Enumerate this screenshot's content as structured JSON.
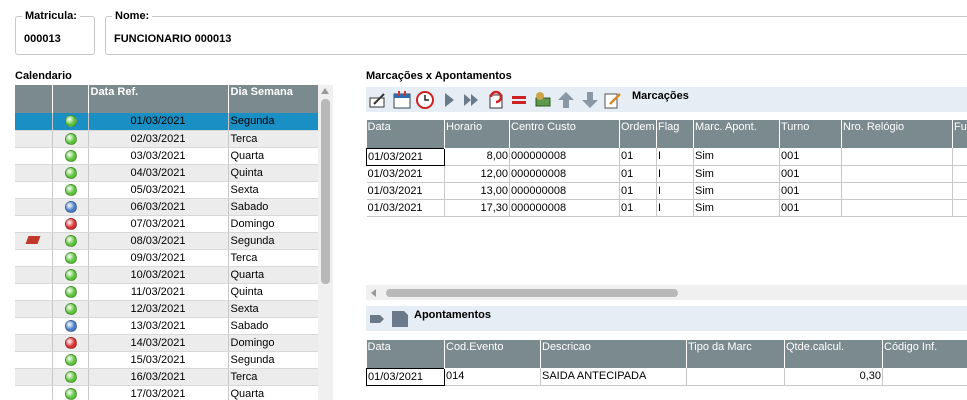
{
  "matricula": {
    "label": "Matricula:",
    "value": "000013"
  },
  "nome": {
    "label": "Nome:",
    "value": "FUNCIONARIO 000013"
  },
  "calendario": {
    "title": "Calendario",
    "columns": [
      "",
      "",
      "Data Ref.",
      "Dia Semana"
    ],
    "rows": [
      {
        "status": "green",
        "flag": false,
        "date": "01/03/2021",
        "day": "Segunda",
        "selected": true
      },
      {
        "status": "green",
        "flag": false,
        "date": "02/03/2021",
        "day": "Terca"
      },
      {
        "status": "green",
        "flag": false,
        "date": "03/03/2021",
        "day": "Quarta"
      },
      {
        "status": "green",
        "flag": false,
        "date": "04/03/2021",
        "day": "Quinta"
      },
      {
        "status": "green",
        "flag": false,
        "date": "05/03/2021",
        "day": "Sexta"
      },
      {
        "status": "blue",
        "flag": false,
        "date": "06/03/2021",
        "day": "Sabado"
      },
      {
        "status": "red",
        "flag": false,
        "date": "07/03/2021",
        "day": "Domingo"
      },
      {
        "status": "green",
        "flag": true,
        "date": "08/03/2021",
        "day": "Segunda"
      },
      {
        "status": "green",
        "flag": false,
        "date": "09/03/2021",
        "day": "Terca"
      },
      {
        "status": "green",
        "flag": false,
        "date": "10/03/2021",
        "day": "Quarta"
      },
      {
        "status": "green",
        "flag": false,
        "date": "11/03/2021",
        "day": "Quinta"
      },
      {
        "status": "green",
        "flag": false,
        "date": "12/03/2021",
        "day": "Sexta"
      },
      {
        "status": "blue",
        "flag": false,
        "date": "13/03/2021",
        "day": "Sabado"
      },
      {
        "status": "red",
        "flag": false,
        "date": "14/03/2021",
        "day": "Domingo"
      },
      {
        "status": "green",
        "flag": false,
        "date": "15/03/2021",
        "day": "Segunda"
      },
      {
        "status": "green",
        "flag": false,
        "date": "16/03/2021",
        "day": "Terca"
      },
      {
        "status": "green",
        "flag": false,
        "date": "17/03/2021",
        "day": "Quarta"
      }
    ]
  },
  "marcacoes_apontamentos": {
    "title": "Marcações x Apontamentos"
  },
  "marcacoes": {
    "toolbar_label": "Marcações",
    "toolbar_icons": [
      "edit-icon",
      "calendar-icon",
      "clock-icon",
      "play-icon",
      "fast-forward-icon",
      "reset-icon",
      "equals-icon",
      "money-icon",
      "arrow-up-icon",
      "arrow-down-icon",
      "note-edit-icon"
    ],
    "columns": [
      "Data",
      "Horario",
      "Centro Custo",
      "Ordem",
      "Flag",
      "Marc. Apont.",
      "Turno",
      "Nro. Relógio",
      "Fu"
    ],
    "rows": [
      [
        "01/03/2021",
        "8,00",
        "000000008",
        "01",
        "I",
        "Sim",
        "001",
        "",
        ""
      ],
      [
        "01/03/2021",
        "12,00",
        "000000008",
        "01",
        "I",
        "Sim",
        "001",
        "",
        ""
      ],
      [
        "01/03/2021",
        "13,00",
        "000000008",
        "01",
        "I",
        "Sim",
        "001",
        "",
        ""
      ],
      [
        "01/03/2021",
        "17,30",
        "000000008",
        "01",
        "I",
        "Sim",
        "001",
        "",
        ""
      ]
    ]
  },
  "apontamentos": {
    "toolbar_label": "Apontamentos",
    "toolbar_icons": [
      "arrow-right-icon",
      "document-icon"
    ],
    "columns": [
      "Data",
      "Cod.Evento",
      "Descricao",
      "Tipo da Marc",
      "Qtde.calcul.",
      "Código Inf."
    ],
    "rows": [
      [
        "01/03/2021",
        "014",
        "SAIDA ANTECIPADA",
        "",
        "0,30",
        ""
      ]
    ]
  },
  "colors": {
    "header_bg": "#7b8a8e",
    "selected_row": "#1a8fc3",
    "toolbar_bg": "#e6edf4",
    "green": "#5cc43a",
    "blue": "#4a7fc8",
    "red": "#d93030"
  }
}
